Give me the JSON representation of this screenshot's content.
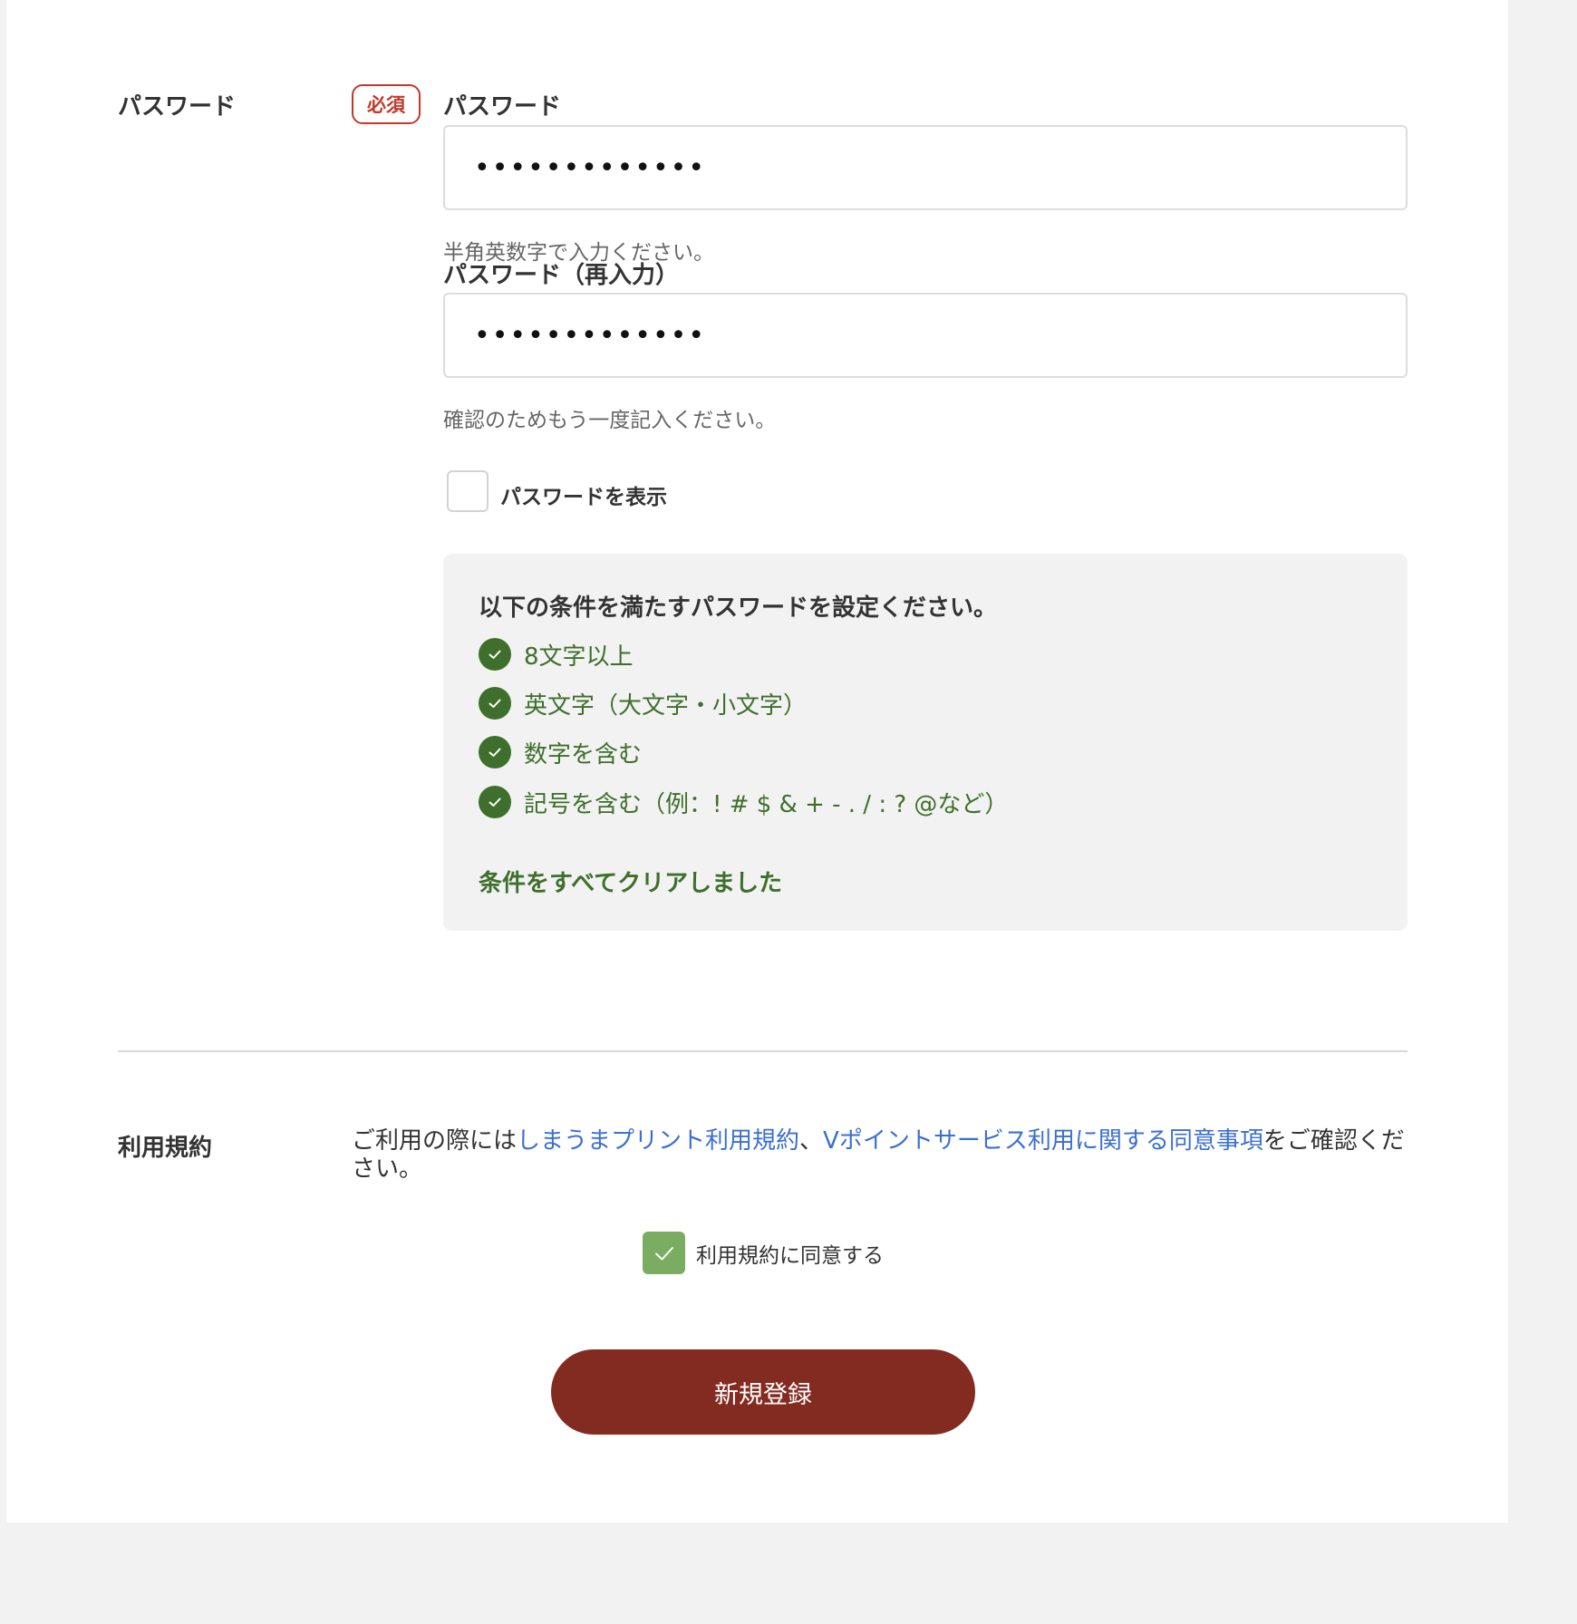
{
  "password_section": {
    "section_label": "パスワード",
    "required_badge": "必須",
    "password": {
      "label": "パスワード",
      "value": "•••••••••••••",
      "hint": "半角英数字で入力ください。"
    },
    "password_confirm": {
      "label": "パスワード（再入力）",
      "value": "•••••••••••••",
      "hint": "確認のためもう一度記入ください。"
    },
    "show_password": {
      "label": "パスワードを表示",
      "checked": false
    },
    "rules": {
      "title": "以下の条件を満たすパスワードを設定ください。",
      "items": [
        {
          "text": "8文字以上",
          "satisfied": true
        },
        {
          "text": "英文字（大文字・小文字）",
          "satisfied": true
        },
        {
          "text": "数字を含む",
          "satisfied": true
        },
        {
          "text": "記号を含む（例：! # $ & + - . / : ? @など）",
          "satisfied": true
        }
      ],
      "status": "条件をすべてクリアしました"
    }
  },
  "terms_section": {
    "section_label": "利用規約",
    "text_before": "ご利用の際には",
    "link_terms": "しまうまプリント利用規約",
    "separator": "、",
    "link_vpoint": "Vポイントサービス利用に関する同意事項",
    "text_after": "をご確認ください。",
    "agree": {
      "label": "利用規約に同意する",
      "checked": true
    }
  },
  "submit": {
    "label": "新規登録"
  },
  "colors": {
    "accent_red": "#832b21",
    "required_red": "#c0392b",
    "success_green": "#3f6f2c",
    "checkbox_green": "#7aad62",
    "link_blue": "#3b6fd1"
  }
}
